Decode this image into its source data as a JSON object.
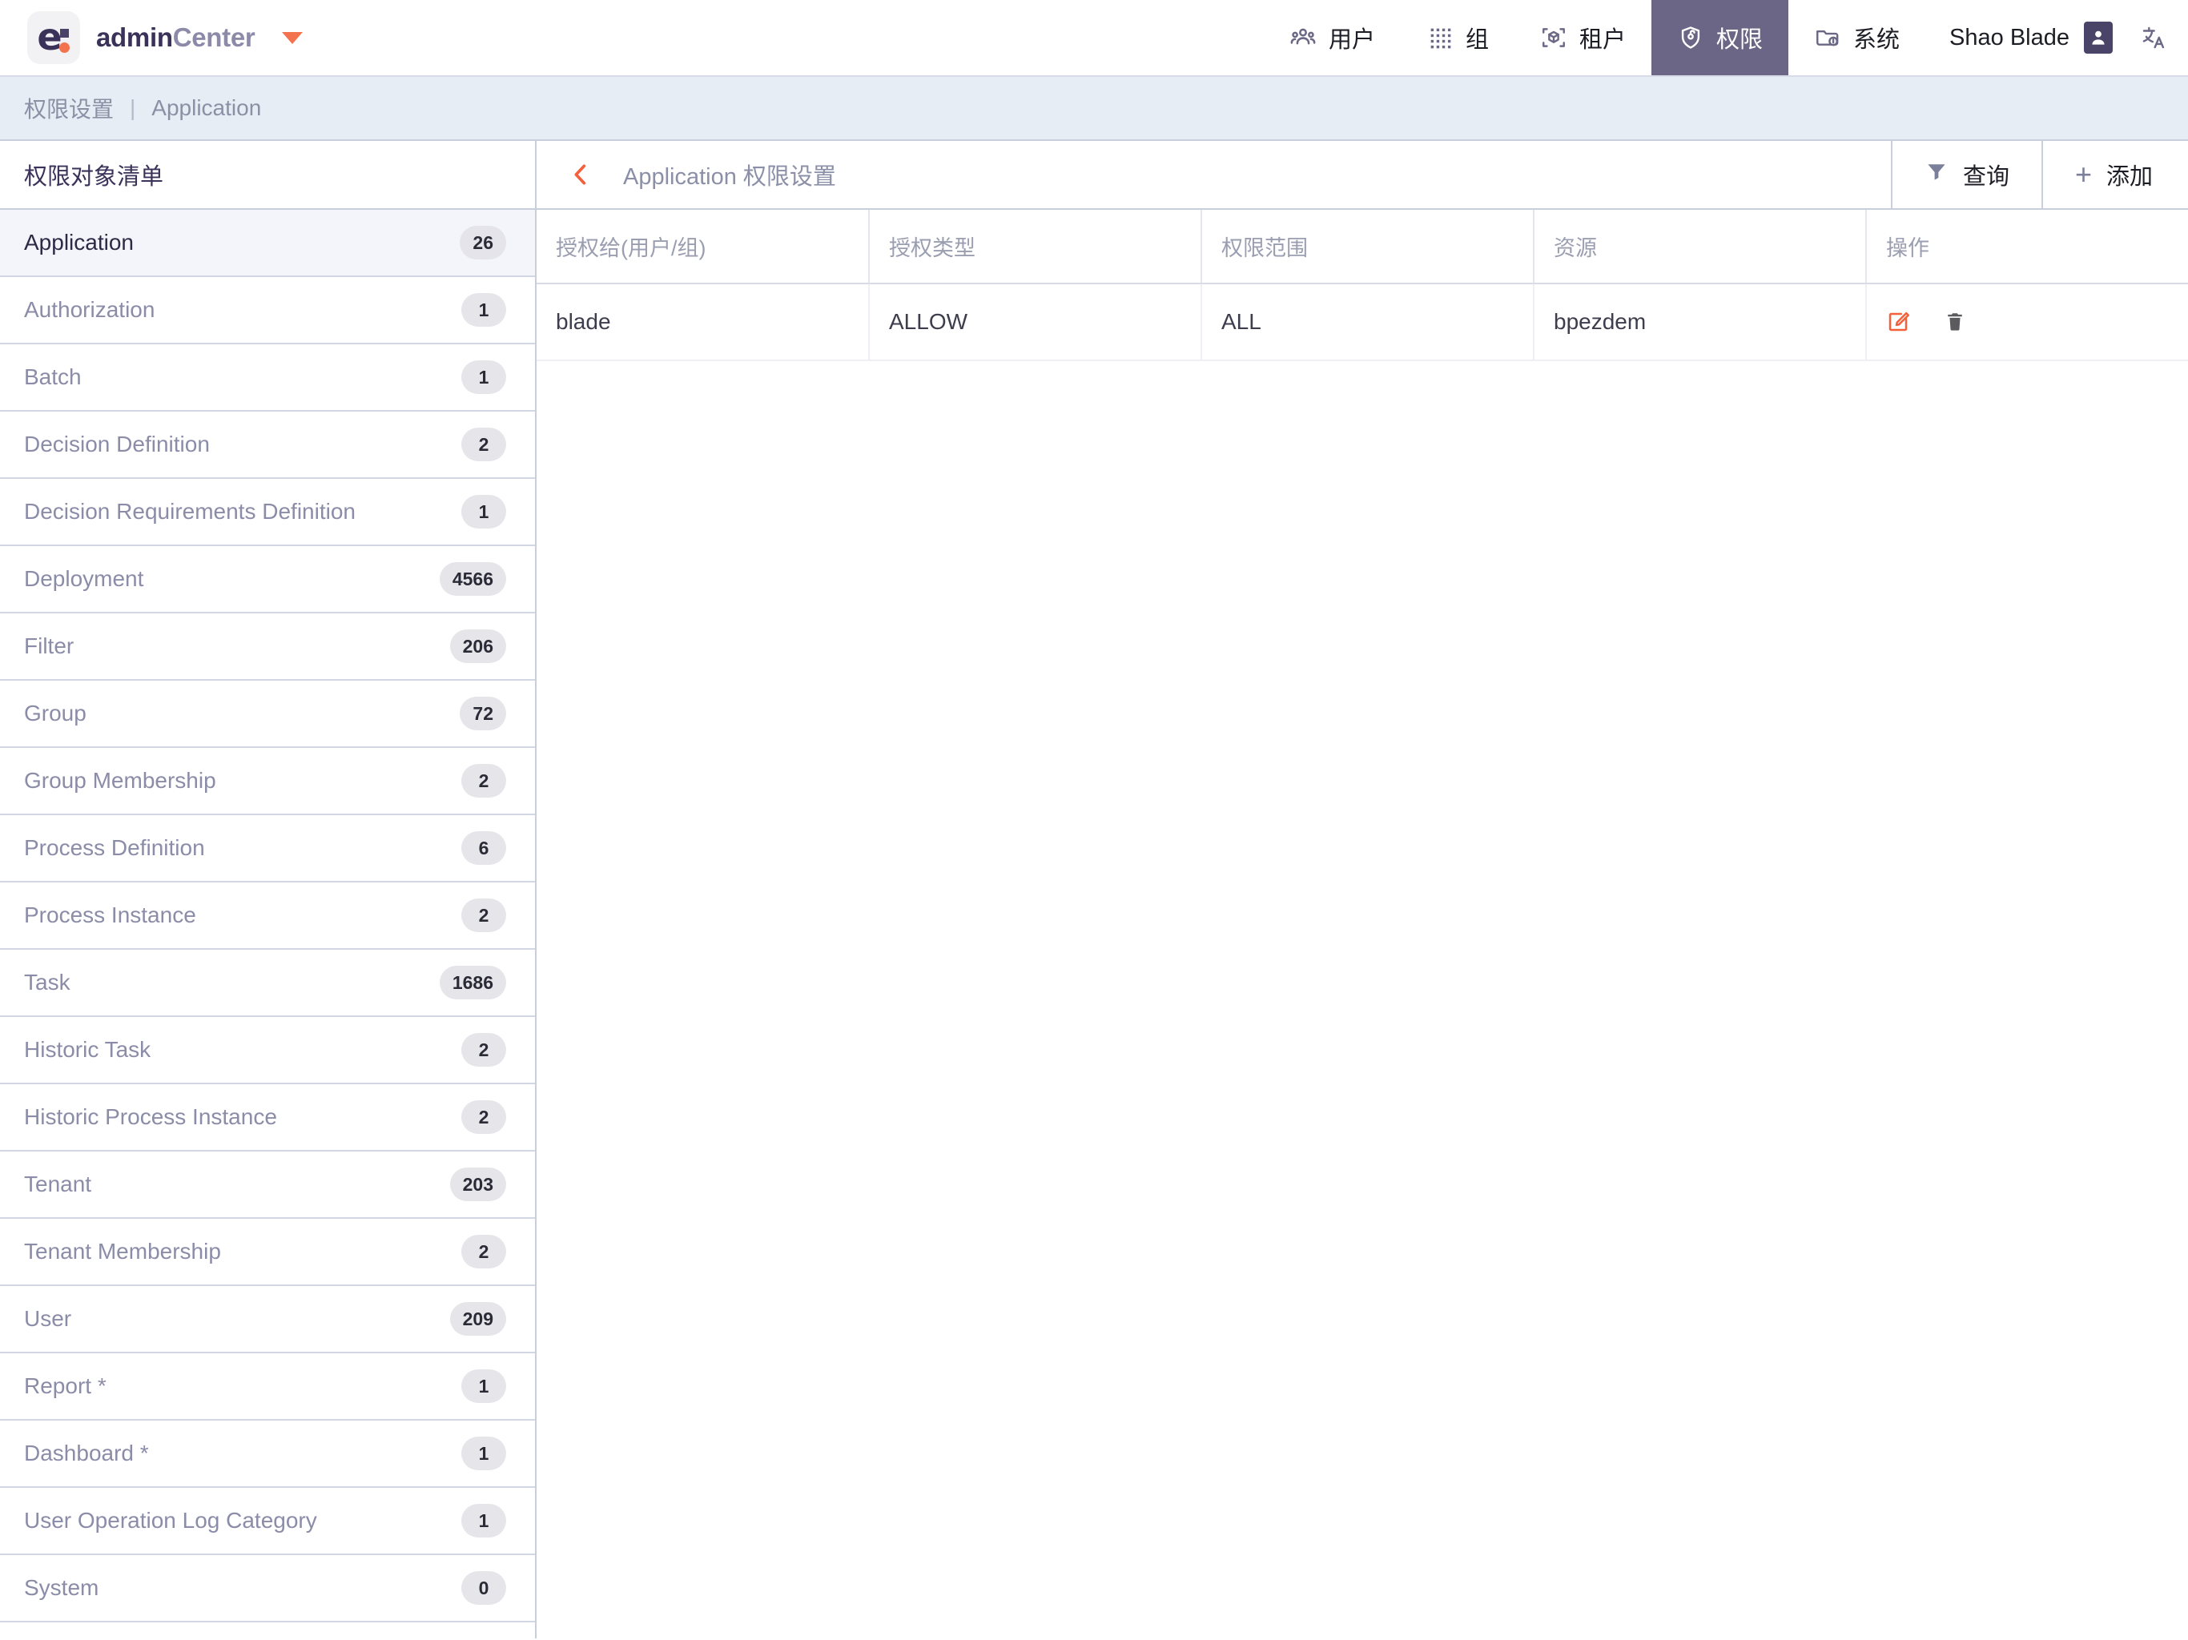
{
  "app": {
    "logo_letter": "e",
    "brand_admin": "admin",
    "brand_center": "Center",
    "accent_color": "#f4734f",
    "nav_active_color": "#6b6686"
  },
  "topnav": {
    "items": [
      {
        "label": "用户",
        "icon": "users-icon",
        "active": false
      },
      {
        "label": "组",
        "icon": "grid-dots-icon",
        "active": false
      },
      {
        "label": "租户",
        "icon": "cube-scan-icon",
        "active": false
      },
      {
        "label": "权限",
        "icon": "shield-lock-icon",
        "active": true
      },
      {
        "label": "系统",
        "icon": "folder-info-icon",
        "active": false
      }
    ],
    "user_name": "Shao Blade",
    "avatar_icon": "person-icon",
    "language_icon": "translate-icon"
  },
  "breadcrumb": {
    "root": "权限设置",
    "separator": "|",
    "current": "Application"
  },
  "sidebar": {
    "title": "权限对象清单",
    "items": [
      {
        "label": "Application",
        "count": "26",
        "selected": true
      },
      {
        "label": "Authorization",
        "count": "1",
        "selected": false
      },
      {
        "label": "Batch",
        "count": "1",
        "selected": false
      },
      {
        "label": "Decision Definition",
        "count": "2",
        "selected": false
      },
      {
        "label": "Decision Requirements Definition",
        "count": "1",
        "selected": false
      },
      {
        "label": "Deployment",
        "count": "4566",
        "selected": false
      },
      {
        "label": "Filter",
        "count": "206",
        "selected": false
      },
      {
        "label": "Group",
        "count": "72",
        "selected": false
      },
      {
        "label": "Group Membership",
        "count": "2",
        "selected": false
      },
      {
        "label": "Process Definition",
        "count": "6",
        "selected": false
      },
      {
        "label": "Process Instance",
        "count": "2",
        "selected": false
      },
      {
        "label": "Task",
        "count": "1686",
        "selected": false
      },
      {
        "label": "Historic Task",
        "count": "2",
        "selected": false
      },
      {
        "label": "Historic Process Instance",
        "count": "2",
        "selected": false
      },
      {
        "label": "Tenant",
        "count": "203",
        "selected": false
      },
      {
        "label": "Tenant Membership",
        "count": "2",
        "selected": false
      },
      {
        "label": "User",
        "count": "209",
        "selected": false
      },
      {
        "label": "Report *",
        "count": "1",
        "selected": false
      },
      {
        "label": "Dashboard *",
        "count": "1",
        "selected": false
      },
      {
        "label": "User Operation Log Category",
        "count": "1",
        "selected": false
      },
      {
        "label": "System",
        "count": "0",
        "selected": false
      }
    ]
  },
  "main": {
    "back_icon": "chevron-left-icon",
    "title": "Application 权限设置",
    "query_button": {
      "label": "查询",
      "icon": "funnel-icon"
    },
    "add_button": {
      "label": "添加",
      "icon": "plus-icon"
    },
    "table": {
      "columns": [
        "授权给(用户/组)",
        "授权类型",
        "权限范围",
        "资源",
        "操作"
      ],
      "rows": [
        {
          "granted_to": "blade",
          "auth_type": "ALLOW",
          "scope": "ALL",
          "resource": "bpezdem",
          "actions": {
            "edit_icon": "edit-pencil-icon",
            "delete_icon": "trash-icon"
          }
        }
      ]
    }
  }
}
